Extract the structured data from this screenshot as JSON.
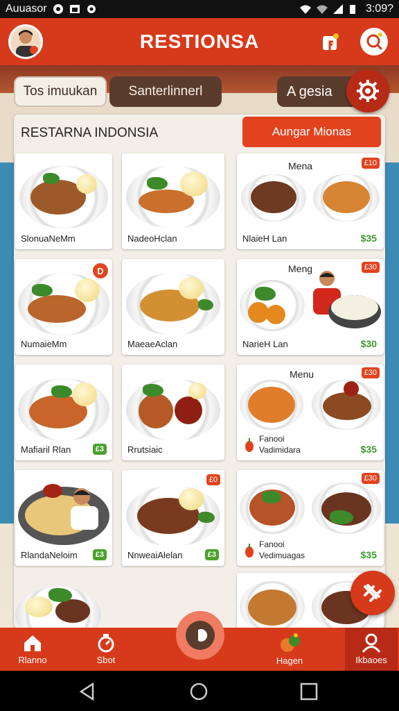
{
  "status_bar": {
    "left_text": "Auuasor",
    "time": "3:09?"
  },
  "header": {
    "title": "RESTIONSA"
  },
  "tabs": {
    "tab1": "Tos imuukan",
    "tab2": "Santerlinnerl",
    "tab3": "A gesia"
  },
  "panel": {
    "title": "RESTARNA INDONSIA",
    "order_button": "Aungar Mionas"
  },
  "cards": [
    {
      "caption": "SlonuaNeMm"
    },
    {
      "caption": "NadeoHclan"
    },
    {
      "menu_label": "Mena",
      "badge": "£10",
      "caption": "NlaieH Lan",
      "price": "$35"
    },
    {
      "caption": "NumaieMm",
      "badge": "D"
    },
    {
      "caption": "MaeaeAclan"
    },
    {
      "menu_label": "Meng",
      "badge": "£30",
      "caption": "NarieH Lan",
      "price": "$30"
    },
    {
      "caption": "Mafiaril Rlan",
      "price": "£3"
    },
    {
      "caption": "Rrutsiaic"
    },
    {
      "menu_label": "Menu",
      "badge": "£30",
      "caption_line1": "Fanooi",
      "caption_line2": "Vadimidara",
      "price": "$35"
    },
    {
      "caption": "RlandaNeloim",
      "price": "£3"
    },
    {
      "caption": "NnweaiAlelan",
      "price": "£3",
      "badge": "£0"
    },
    {
      "badge": "£30",
      "caption_line1": "Fanooi",
      "caption_line2": "Vedimuagas",
      "price": "$35"
    }
  ],
  "bottom_nav": {
    "home": "Rlanno",
    "stat": "Sbot",
    "hagen": "Hagen",
    "kbaoes": "Ikbaoes"
  },
  "colors": {
    "primary": "#d63a1a",
    "accent": "#e2431e",
    "brown": "#5a3c2c",
    "price_green": "#3c9b2b"
  }
}
